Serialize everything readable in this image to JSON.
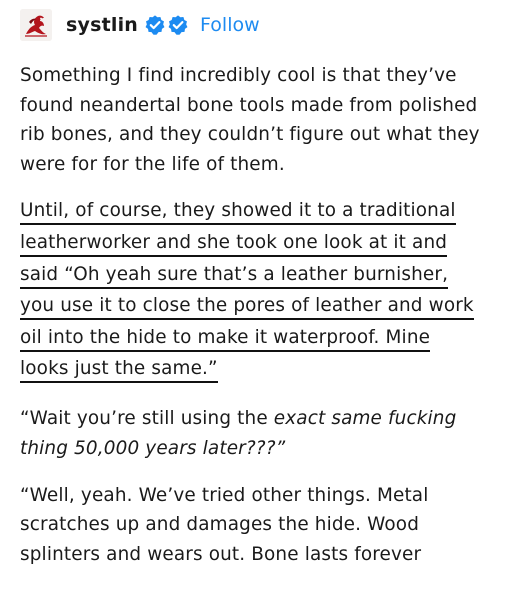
{
  "header": {
    "username": "systlin",
    "follow_label": "Follow",
    "accent_color": "#1d8bf1",
    "badge_icons": [
      "verified-badge-icon",
      "verified-badge-icon"
    ]
  },
  "post": {
    "para1": [
      "Something I find incredibly cool is that they’ve",
      "found neandertal bone tools made from polished",
      "rib bones, and they couldn’t figure out what they",
      "were for for the life of them."
    ],
    "para2": [
      "Until, of course, they showed it to a traditional",
      "leatherworker and she took one look at it and",
      "said “Oh yeah sure that’s a leather burnisher,",
      "you use it to close the pores of leather and work",
      "oil into the hide to make it waterproof. Mine",
      "looks just the same.”"
    ],
    "para3": {
      "line1_pre": "“Wait you’re still using the ",
      "line1_em": "exact same fucking",
      "line2_em": "thing 50,000 years later???”"
    },
    "para4": [
      "“Well, yeah. We’ve tried other things. Metal",
      "scratches up and damages the hide. Wood",
      "splinters and wears out. Bone lasts forever"
    ]
  }
}
